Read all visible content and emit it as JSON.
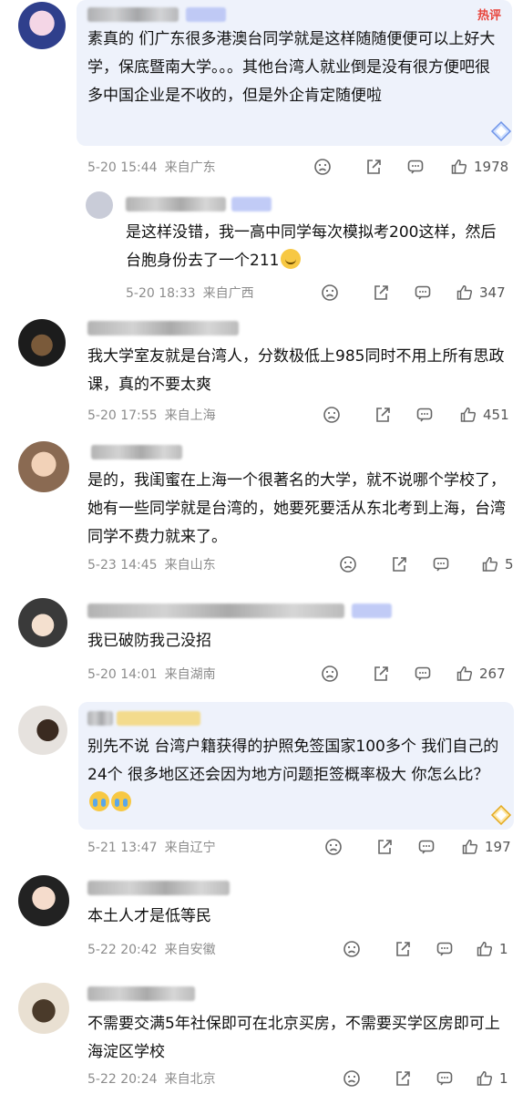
{
  "hot_label": "热评",
  "comments": [
    {
      "text": "素真的 们广东很多港澳台同学就是这样随随便便可以上好大学，保底暨南大学。。。其他台湾人就业倒是没有很方便吧很多中国企业是不收的，但是外企肯定随便啦",
      "time": "5-20 15:44",
      "source": "来自广东",
      "likes": "1978"
    },
    {
      "text": "是这样没错，我一高中同学每次模拟考200这样，然后台胞身份去了一个211",
      "time": "5-20 18:33",
      "source": "来自广西",
      "likes": "347"
    },
    {
      "text": "我大学室友就是台湾人，分数极低上985同时不用上所有思政课，真的不要太爽",
      "time": "5-20 17:55",
      "source": "来自上海",
      "likes": "451"
    },
    {
      "text": "是的，我闺蜜在上海一个很著名的大学，就不说哪个学校了，她有一些同学就是台湾的，她要死要活从东北考到上海，台湾同学不费力就来了。",
      "time": "5-23 14:45",
      "source": "来自山东",
      "likes": "5"
    },
    {
      "text": "我已破防我己没招",
      "time": "5-20 14:01",
      "source": "来自湖南",
      "likes": "267"
    },
    {
      "text": "别先不说 台湾户籍获得的护照免签国家100多个 我们自己的24个 很多地区还会因为地方问题拒签概率极大 你怎么比？",
      "time": "5-21 13:47",
      "source": "来自辽宁",
      "likes": "197"
    },
    {
      "text": "本土人才是低等民",
      "time": "5-22 20:42",
      "source": "来自安徽",
      "likes": "1"
    },
    {
      "text": "不需要交满5年社保即可在北京买房，不需要买学区房即可上海淀区学校",
      "time": "5-22 20:24",
      "source": "来自北京",
      "likes": "1"
    }
  ],
  "icons": {
    "dislike": "frown-icon",
    "share": "share-icon",
    "reply": "comment-icon",
    "like": "thumbs-up-icon"
  },
  "colors": {
    "hot": "#e8453c",
    "meta": "#8c8c8c"
  }
}
